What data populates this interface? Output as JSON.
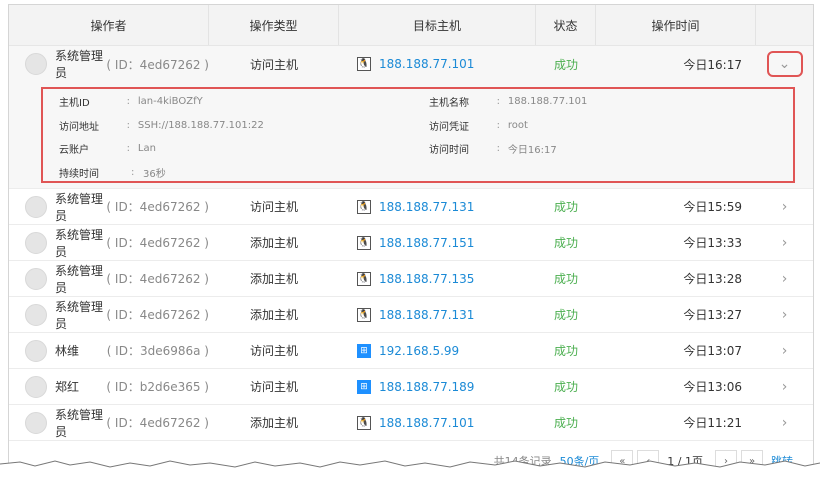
{
  "columns": [
    "操作者",
    "操作类型",
    "目标主机",
    "状态",
    "操作时间"
  ],
  "rows": [
    {
      "name": "系统管理员",
      "id": "( ID：4ed67262 )",
      "type": "访问主机",
      "os": "linux",
      "host": "188.188.77.101",
      "status": "成功",
      "time": "今日16:17"
    },
    {
      "name": "系统管理员",
      "id": "( ID：4ed67262 )",
      "type": "访问主机",
      "os": "linux",
      "host": "188.188.77.131",
      "status": "成功",
      "time": "今日15:59"
    },
    {
      "name": "系统管理员",
      "id": "( ID：4ed67262 )",
      "type": "添加主机",
      "os": "linux",
      "host": "188.188.77.151",
      "status": "成功",
      "time": "今日13:33"
    },
    {
      "name": "系统管理员",
      "id": "( ID：4ed67262 )",
      "type": "添加主机",
      "os": "linux",
      "host": "188.188.77.135",
      "status": "成功",
      "time": "今日13:28"
    },
    {
      "name": "系统管理员",
      "id": "( ID：4ed67262 )",
      "type": "添加主机",
      "os": "linux",
      "host": "188.188.77.131",
      "status": "成功",
      "time": "今日13:27"
    },
    {
      "name": "林维",
      "id": "( ID：3de6986a )",
      "type": "访问主机",
      "os": "windows",
      "host": "192.168.5.99",
      "status": "成功",
      "time": "今日13:07"
    },
    {
      "name": "郑红",
      "id": "( ID：b2d6e365 )",
      "type": "访问主机",
      "os": "windows",
      "host": "188.188.77.189",
      "status": "成功",
      "time": "今日13:06"
    },
    {
      "name": "系统管理员",
      "id": "( ID：4ed67262 )",
      "type": "添加主机",
      "os": "linux",
      "host": "188.188.77.101",
      "status": "成功",
      "time": "今日11:21"
    }
  ],
  "detail": {
    "host_id_label": "主机ID",
    "host_id": "lan-4kiBOZfY",
    "host_name_label": "主机名称",
    "host_name": "188.188.77.101",
    "address_label": "访问地址",
    "address": "SSH://188.188.77.101:22",
    "credential_label": "访问凭证",
    "credential": "root",
    "cloud_account_label": "云账户",
    "cloud_account": "Lan",
    "access_time_label": "访问时间",
    "access_time": "今日16:17",
    "duration_label": "持续时间",
    "duration": "36秒",
    "separator": ":"
  },
  "pager": {
    "total": "共14条记录",
    "per_page": "50条/页",
    "first": "«",
    "prev": "‹",
    "page": "1 / 1页",
    "next": "›",
    "last": "»",
    "jump": "跳转"
  },
  "icons": {
    "linux": "linux-icon",
    "windows": "windows-icon",
    "chevron_down": "chevron-down-icon",
    "chevron_right": "chevron-right-icon"
  },
  "colors": {
    "link": "#1b8ad6",
    "success": "#4caf50",
    "highlight": "#e05555"
  }
}
